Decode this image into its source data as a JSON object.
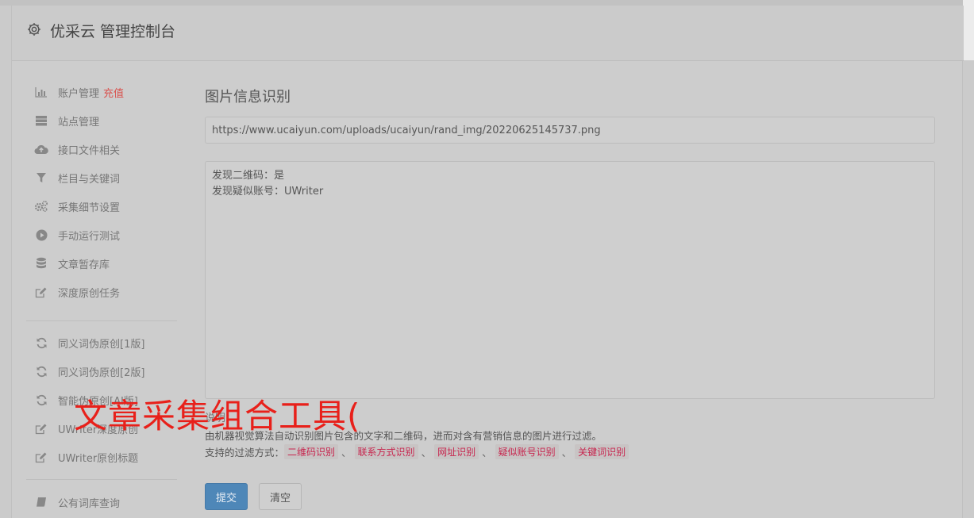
{
  "header": {
    "title": "优采云 管理控制台"
  },
  "sidebar": {
    "items": [
      {
        "label": "账户管理",
        "extra": "充值",
        "icon": "bar-chart-icon"
      },
      {
        "label": "站点管理",
        "icon": "server-icon"
      },
      {
        "label": "接口文件相关",
        "icon": "cloud-upload-icon"
      },
      {
        "label": "栏目与关键词",
        "icon": "filter-icon"
      },
      {
        "label": "采集细节设置",
        "icon": "gears-icon"
      },
      {
        "label": "手动运行测试",
        "icon": "play-circle-icon"
      },
      {
        "label": "文章暂存库",
        "icon": "database-icon"
      },
      {
        "label": "深度原创任务",
        "icon": "edit-icon"
      },
      {
        "label": "同义词伪原创[1版]",
        "icon": "refresh-icon"
      },
      {
        "label": "同义词伪原创[2版]",
        "icon": "refresh-icon"
      },
      {
        "label": "智能伪原创[AI版]",
        "icon": "refresh-icon"
      },
      {
        "label": "UWriter深度原创",
        "icon": "edit-icon"
      },
      {
        "label": "UWriter原创标题",
        "icon": "edit-icon"
      },
      {
        "label": "公有词库查询",
        "icon": "book-icon"
      }
    ]
  },
  "main": {
    "title": "图片信息识别",
    "url_value": "https://www.ucaiyun.com/uploads/ucaiyun/rand_img/20220625145737.png",
    "result_lines": [
      "发现二维码：是",
      "发现疑似账号：UWriter"
    ],
    "help_label": "说明：",
    "help_desc": "由机器视觉算法自动识别图片包含的文字和二维码，进而对含有营销信息的图片进行过滤。",
    "modes_label": "支持的过滤方式：",
    "modes": [
      "二维码识别",
      "联系方式识别",
      "网址识别",
      "疑似账号识别",
      "关键词识别"
    ],
    "submit_label": "提交",
    "clear_label": "清空"
  },
  "watermark": "文章采集组合工具(",
  "colors": {
    "accent": "#4e87b8",
    "warning": "#d9534f",
    "tag_text": "#c7254e",
    "watermark": "#e8201a"
  }
}
